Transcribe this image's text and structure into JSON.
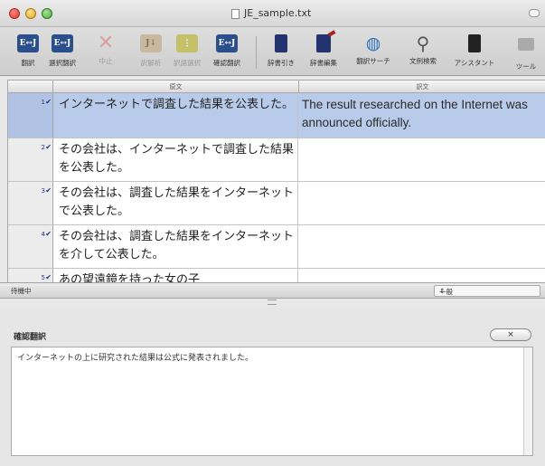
{
  "window": {
    "title": "JE_sample.txt"
  },
  "toolbar": {
    "buttons": [
      {
        "label": "翻訳",
        "icon": "translate-icon",
        "enabled": true
      },
      {
        "label": "選択翻訳",
        "icon": "translate-selection-icon",
        "enabled": true
      },
      {
        "label": "中止",
        "icon": "stop-icon",
        "enabled": false
      },
      {
        "label": "訳解析",
        "icon": "analyze-icon",
        "enabled": false
      },
      {
        "label": "訳語選択",
        "icon": "word-choice-icon",
        "enabled": false
      },
      {
        "label": "確認翻訳",
        "icon": "confirm-translation-icon",
        "enabled": true
      },
      {
        "label": "辞書引き",
        "icon": "dictionary-lookup-icon",
        "enabled": true
      },
      {
        "label": "辞書編集",
        "icon": "dictionary-edit-icon",
        "enabled": true
      },
      {
        "label": "翻訳サーチ",
        "icon": "translation-search-icon",
        "enabled": true
      },
      {
        "label": "文例検索",
        "icon": "example-search-icon",
        "enabled": true
      },
      {
        "label": "アシスタント",
        "icon": "assistant-icon",
        "enabled": true
      },
      {
        "label": "ツール",
        "icon": "tools-icon",
        "enabled": true
      }
    ]
  },
  "grid": {
    "header_source": "原文",
    "header_target": "訳文",
    "rows": [
      {
        "num": "1",
        "source": "インターネットで調査した結果を公表した。",
        "target": "The result researched on the Internet was announced officially.",
        "selected": true
      },
      {
        "num": "2",
        "source": "その会社は、インターネットで調査した結果を公表した。",
        "target": "",
        "selected": false
      },
      {
        "num": "3",
        "source": "その会社は、調査した結果をインターネットで公表した。",
        "target": "",
        "selected": false
      },
      {
        "num": "4",
        "source": "その会社は、調査した結果をインターネットを介して公表した。",
        "target": "",
        "selected": false
      },
      {
        "num": "5",
        "source": "あの望遠鏡を持った女の子",
        "target": "",
        "selected": false
      }
    ]
  },
  "status": {
    "text": "待機中",
    "mode": "一般"
  },
  "confirm": {
    "title": "確認翻訳",
    "close_label": "×",
    "text": "インターネットの上に研究された結果は公式に発表されました。"
  },
  "colors": {
    "selected_row": "#b9cbea",
    "toolbar_bg": "#d6d6d6",
    "pane_bg": "#e6e6e6"
  }
}
